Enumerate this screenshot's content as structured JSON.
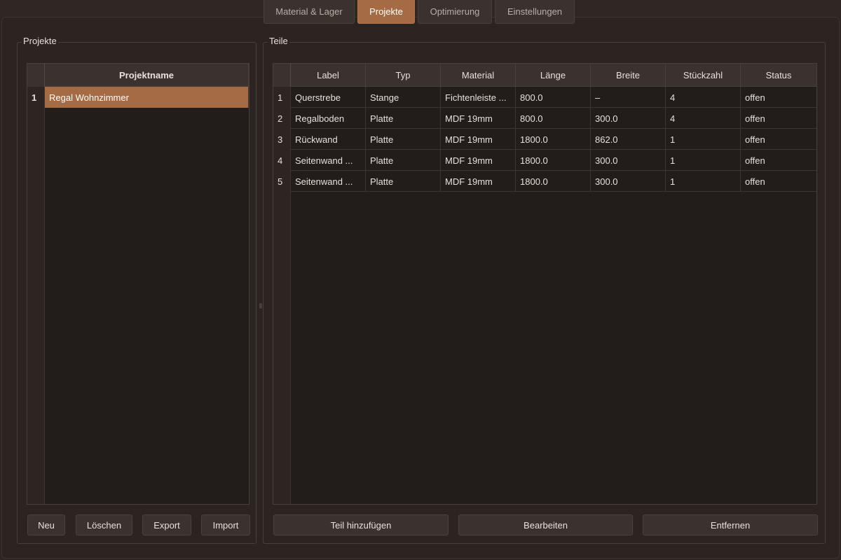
{
  "tabs": [
    {
      "label": "Material & Lager",
      "active": false
    },
    {
      "label": "Projekte",
      "active": true
    },
    {
      "label": "Optimierung",
      "active": false
    },
    {
      "label": "Einstellungen",
      "active": false
    }
  ],
  "colors": {
    "accent": "#a56b45",
    "background": "#2b2421",
    "table_bg": "#221c1a",
    "header_bg": "#3a322e"
  },
  "projects": {
    "group_title": "Projekte",
    "column_header": "Projektname",
    "rows": [
      {
        "num": "1",
        "name": "Regal Wohnzimmer",
        "selected": true
      }
    ],
    "buttons": {
      "new": "Neu",
      "delete": "Löschen",
      "export": "Export",
      "import": "Import"
    }
  },
  "parts": {
    "group_title": "Teile",
    "columns": [
      "Label",
      "Typ",
      "Material",
      "Länge",
      "Breite",
      "Stückzahl",
      "Status"
    ],
    "rows": [
      {
        "num": "1",
        "cells": [
          "Querstrebe",
          "Stange",
          "Fichtenleiste ...",
          "800.0",
          "–",
          "4",
          "offen"
        ]
      },
      {
        "num": "2",
        "cells": [
          "Regalboden",
          "Platte",
          "MDF 19mm",
          "800.0",
          "300.0",
          "4",
          "offen"
        ]
      },
      {
        "num": "3",
        "cells": [
          "Rückwand",
          "Platte",
          "MDF 19mm",
          "1800.0",
          "862.0",
          "1",
          "offen"
        ]
      },
      {
        "num": "4",
        "cells": [
          "Seitenwand ...",
          "Platte",
          "MDF 19mm",
          "1800.0",
          "300.0",
          "1",
          "offen"
        ]
      },
      {
        "num": "5",
        "cells": [
          "Seitenwand ...",
          "Platte",
          "MDF 19mm",
          "1800.0",
          "300.0",
          "1",
          "offen"
        ]
      }
    ],
    "buttons": {
      "add": "Teil hinzufügen",
      "edit": "Bearbeiten",
      "remove": "Entfernen"
    }
  }
}
